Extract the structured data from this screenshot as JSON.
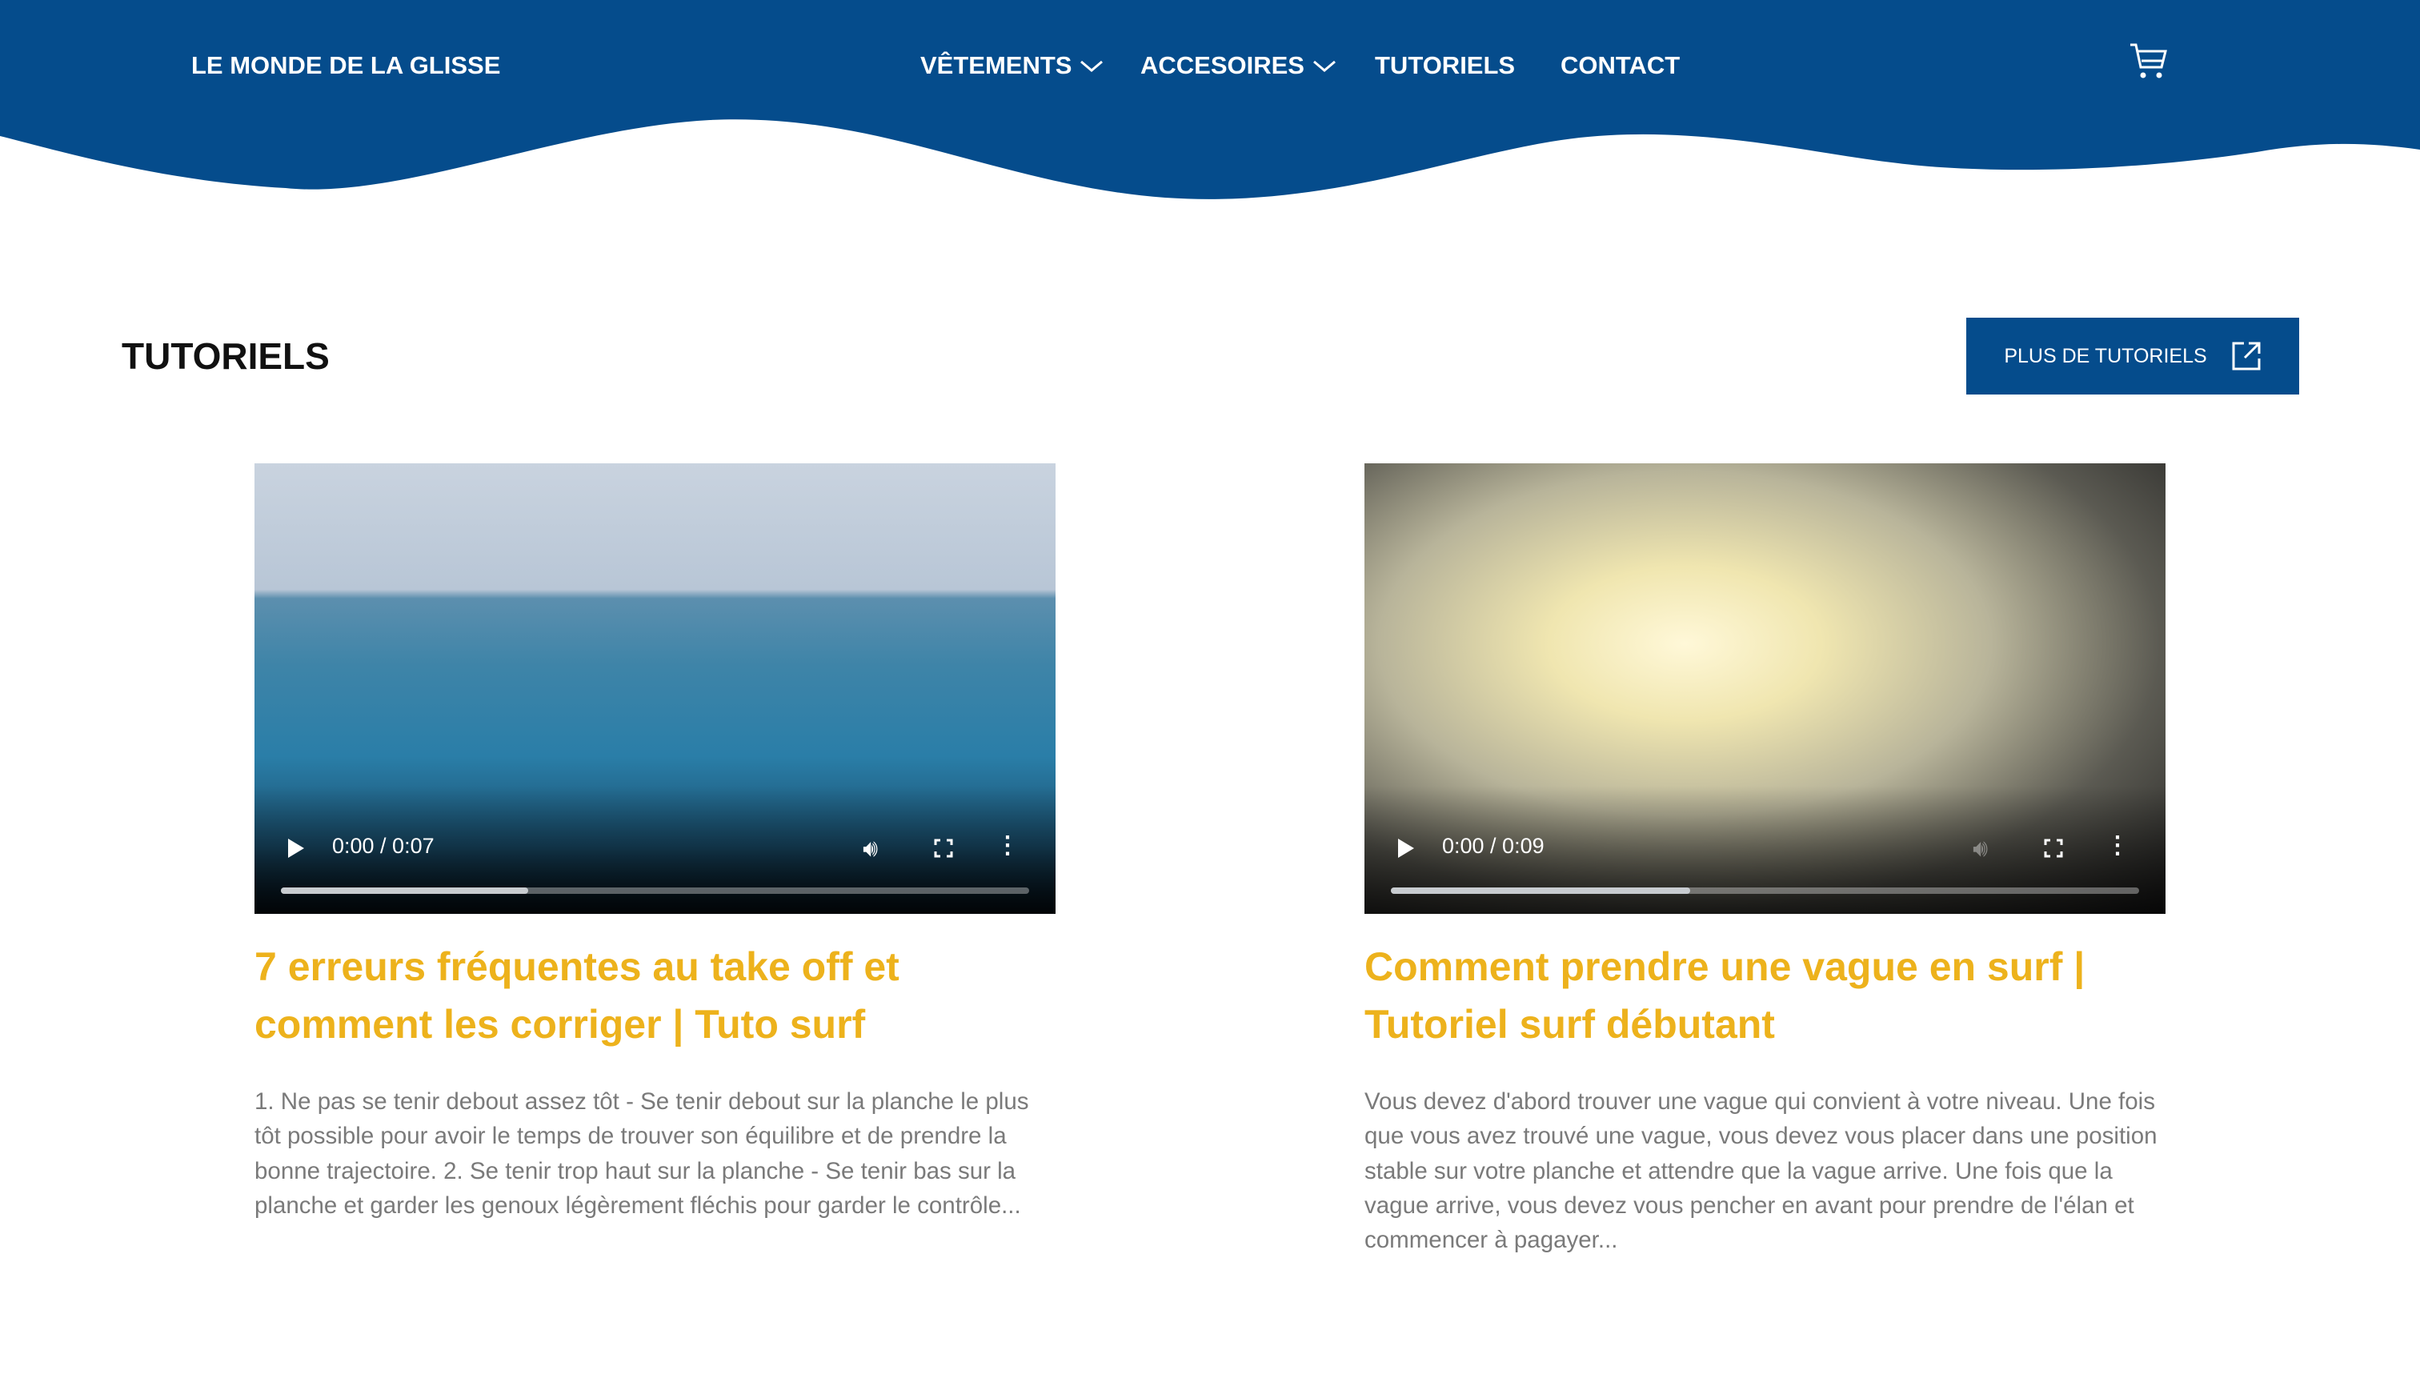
{
  "header": {
    "logo": "LE MONDE DE LA GLISSE",
    "nav": [
      {
        "label": "VÊTEMENTS"
      },
      {
        "label": "ACCESOIRES"
      },
      {
        "label": "TUTORIELS"
      },
      {
        "label": "CONTACT"
      }
    ],
    "cart_icon": "cart-icon",
    "color": "#054c8c"
  },
  "section": {
    "title": "TUTORIELS",
    "more_button": "PLUS DE TUTORIELS"
  },
  "videos": [
    {
      "time": "0:00 / 0:07",
      "progress": 0.33,
      "title": "7 erreurs fréquentes au take off et comment les corriger | Tuto surf",
      "description": "1. Ne pas se tenir debout assez tôt - Se tenir debout sur la planche le plus tôt possible pour avoir le temps de trouver son équilibre et de prendre la bonne trajectoire. 2. Se tenir trop haut sur la planche - Se tenir bas sur la planche et garder les genoux légèrement fléchis pour garder le contrôle..."
    },
    {
      "time": "0:00 / 0:09",
      "progress": 0.4,
      "title": "Comment prendre une vague en surf | Tutoriel surf débutant",
      "description": "Vous devez d'abord trouver une vague qui convient à votre niveau. Une fois que vous avez trouvé une vague, vous devez vous placer dans une position stable sur votre planche et attendre que la vague arrive. Une fois que la vague arrive, vous devez vous pencher en avant pour prendre de l'élan et commencer à pagayer..."
    }
  ],
  "accent": "#edb21c"
}
